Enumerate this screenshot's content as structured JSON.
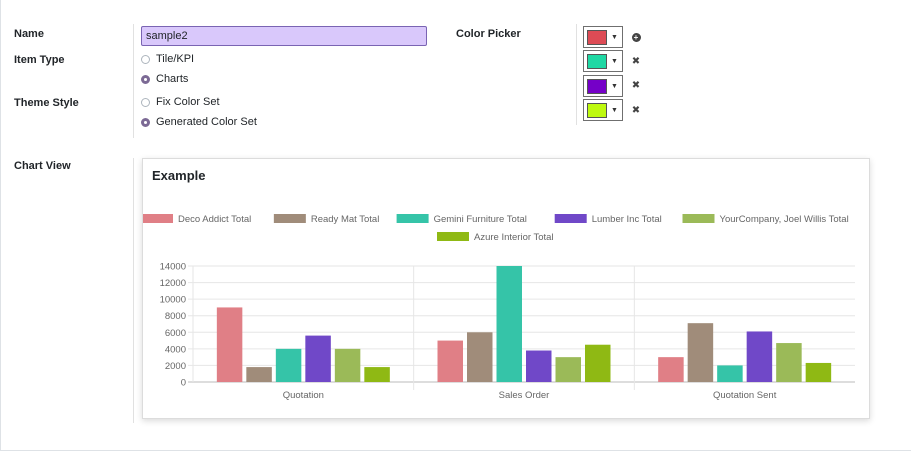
{
  "form": {
    "name_label": "Name",
    "name_value": "sample2",
    "item_type_label": "Item Type",
    "item_type_options": [
      "Tile/KPI",
      "Charts"
    ],
    "item_type_selected": "Charts",
    "theme_style_label": "Theme Style",
    "theme_style_options": [
      "Fix Color Set",
      "Generated Color Set"
    ],
    "theme_style_selected": "Generated Color Set",
    "color_picker_label": "Color Picker",
    "colors": [
      "#dd4b55",
      "#1fd8a4",
      "#7500c8",
      "#bef90f"
    ],
    "color_actions": [
      "plus-circle-icon",
      "close-icon",
      "close-icon",
      "close-icon"
    ],
    "chart_view_label": "Chart View"
  },
  "chart_card": {
    "title": "Example"
  },
  "chart_data": {
    "type": "bar",
    "title": "Example",
    "categories": [
      "Quotation",
      "Sales Order",
      "Quotation Sent"
    ],
    "ylim": [
      0,
      14000
    ],
    "yticks": [
      0,
      2000,
      4000,
      6000,
      8000,
      10000,
      12000,
      14000
    ],
    "grid": true,
    "legend_position": "top",
    "series": [
      {
        "name": "Deco Addict Total",
        "color": "#e07f86",
        "values": [
          9000,
          5000,
          3000
        ]
      },
      {
        "name": "Ready Mat Total",
        "color": "#a08c7a",
        "values": [
          1800,
          6000,
          7100
        ]
      },
      {
        "name": "Gemini Furniture Total",
        "color": "#35c4a8",
        "values": [
          4000,
          14000,
          2000
        ]
      },
      {
        "name": "Lumber Inc Total",
        "color": "#7048c8",
        "values": [
          5600,
          3800,
          6100
        ]
      },
      {
        "name": "YourCompany, Joel Willis Total",
        "color": "#9bba58",
        "values": [
          4000,
          3000,
          4700
        ]
      },
      {
        "name": "Azure Interior Total",
        "color": "#8fb914",
        "values": [
          1800,
          4500,
          2300
        ]
      }
    ]
  }
}
